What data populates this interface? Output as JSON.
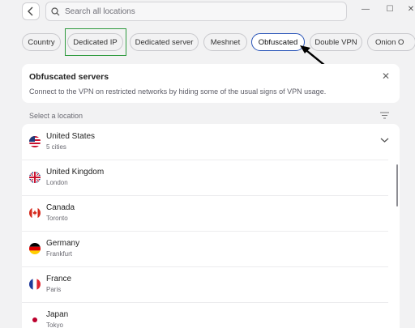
{
  "search": {
    "placeholder": "Search all locations"
  },
  "window_controls": {
    "minimize": "—",
    "maximize": "☐",
    "close": "✕"
  },
  "filters": [
    {
      "label": "Country",
      "selected": false
    },
    {
      "label": "Dedicated IP",
      "selected": false
    },
    {
      "label": "Dedicated server",
      "selected": false
    },
    {
      "label": "Meshnet",
      "selected": false
    },
    {
      "label": "Obfuscated",
      "selected": true
    },
    {
      "label": "Double VPN",
      "selected": false
    },
    {
      "label": "Onion O",
      "selected": false
    }
  ],
  "banner": {
    "title": "Obfuscated servers",
    "text": "Connect to the VPN on restricted networks by hiding some of the usual signs of VPN usage.",
    "close": "✕"
  },
  "section": {
    "label": "Select a location"
  },
  "locations": [
    {
      "name": "United States",
      "sub": "5 cities",
      "flag": "us-flag"
    },
    {
      "name": "United Kingdom",
      "sub": "London",
      "flag": "uk-flag"
    },
    {
      "name": "Canada",
      "sub": "Toronto",
      "flag": "canada-flag"
    },
    {
      "name": "Germany",
      "sub": "Frankfurt",
      "flag": "germany-flag"
    },
    {
      "name": "France",
      "sub": "Paris",
      "flag": "france-flag"
    },
    {
      "name": "Japan",
      "sub": "Tokyo",
      "flag": "japan-flag"
    }
  ],
  "colors": {
    "selected_border": "#2a55b8",
    "highlight_box": "#2e9a3e",
    "annotation_arrow": "#000000"
  }
}
